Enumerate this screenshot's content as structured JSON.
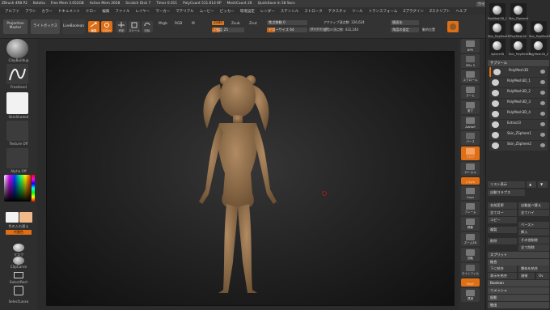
{
  "titlebar": {
    "items": [
      "ZBrush 4R8 P2",
      "Kotoha",
      "Free Mem 3.052GB",
      "Active Mem 2658",
      "Scratch Disk 7",
      "Timer 0.011",
      "PolyCount 511.614 KP",
      "MeshCount 26",
      "QuickSave In 58 Secs"
    ],
    "ui_button": "ウインドウ表示",
    "menu_button": "Menu",
    "default_button": "DefaultZScript"
  },
  "menubar": {
    "items": [
      "アルファ",
      "ブラシ",
      "カラー",
      "ドキュメント",
      "ドロー",
      "編集",
      "ファイル",
      "レイヤー",
      "マーカー",
      "マテリアル",
      "ムービー",
      "ピッカー",
      "環境設定",
      "レンダー",
      "ステンシル",
      "ストローク",
      "テクスチャ",
      "ツール",
      "トランスフォーム",
      "Zプラグイン",
      "Zスクリプト",
      "ヘルプ"
    ]
  },
  "shelf": {
    "projection_master": "Projection Master",
    "lightbox": "ライトボックス",
    "live_boolean": "LiveBoolean",
    "edit": "編集",
    "draw": "ドロー",
    "move": "移動",
    "scale": "スケール",
    "rotate": "回転",
    "mrgb": "Mrgb",
    "rgb": "RGB",
    "m": "M",
    "zadd": "Zadd",
    "zsub": "Zsub",
    "zcut": "Zcut",
    "focal_shift": "焦点移動 0",
    "intensity": "Z強度 25",
    "draw_size": "ドローサイズ 64",
    "dynamic": "ダイナミック",
    "active_points": "アクティブ頂点数: 326,624",
    "total_points": "全ての頂点数: 432,244",
    "symmetry_label": "鏡面化",
    "adjust_label": "角度の設定",
    "geometry_label": "動的位置"
  },
  "lefttray": {
    "brush_1": "ClayBuildup",
    "brush_2": "FreeHand",
    "brush_3": "SkinShade4",
    "texture": "Texture Off",
    "alpha": "Alpha Off",
    "gradient": "グラデーション",
    "switch_color": "色の入れ替え",
    "alternate": "代替色",
    "mask_label": "マスク",
    "selector_1": "ClipCurve",
    "selector_2": "SelectRect",
    "selector_3": "SelectLasso",
    "colors": {
      "main": "#f2f2f2",
      "secondary": "#f0b98a",
      "accent": "#e06e14"
    }
  },
  "rightcol": {
    "buttons": [
      "BPR",
      "SPix 3",
      "スクロール",
      "ズーム",
      "実寸",
      "AAHalf",
      "パース",
      "フロア",
      "ローカル",
      "L.Sym",
      "Gxyz",
      "フレーム",
      "移動",
      "ズーム3D",
      "回転",
      "ラインフィル",
      "PolyF",
      "透過",
      "Ghost",
      "Solo",
      "Xpose"
    ]
  },
  "subtool": {
    "thumbs": [
      "PolyMesh3D_1",
      "Skin_ZSphere1",
      "Skin_PolyMesh3D",
      "PolyMesh3D",
      "Skin_PolyMesh3D",
      "Sphere3D",
      "Skin_PolyMesh3D_1",
      "PolyMesh3D_2"
    ],
    "header": "サブツール",
    "items": [
      "PolyMesh3D",
      "PolyMesh3D_1",
      "PolyMesh3D_2",
      "PolyMesh3D_3",
      "PolyMesh3D_4",
      "Extract3",
      "Skin_ZSphere1",
      "Skin_ZSphere2"
    ],
    "list_all": "リスト表示",
    "auto_collapse": "自動コラプス",
    "rename": "名前変更",
    "auto_reorder": "自動並べ替え",
    "all_low": "全てロー",
    "all_high": "全てハイ",
    "copy": "コピー",
    "paste": "ペースト",
    "duplicate": "複製",
    "append": "挿入",
    "delete": "削除",
    "del_other": "その他削除",
    "del_all": "全て削除",
    "split": "スプリット",
    "merge": "結合",
    "merge_down": "下に結合",
    "merge_similar": "類似を結合",
    "merge_visible": "表示を結合",
    "weld": "溶接",
    "uv": "Uv",
    "boolean": "Boolean",
    "remesh": "リメッシュ",
    "project": "投影",
    "extract": "抽出"
  }
}
